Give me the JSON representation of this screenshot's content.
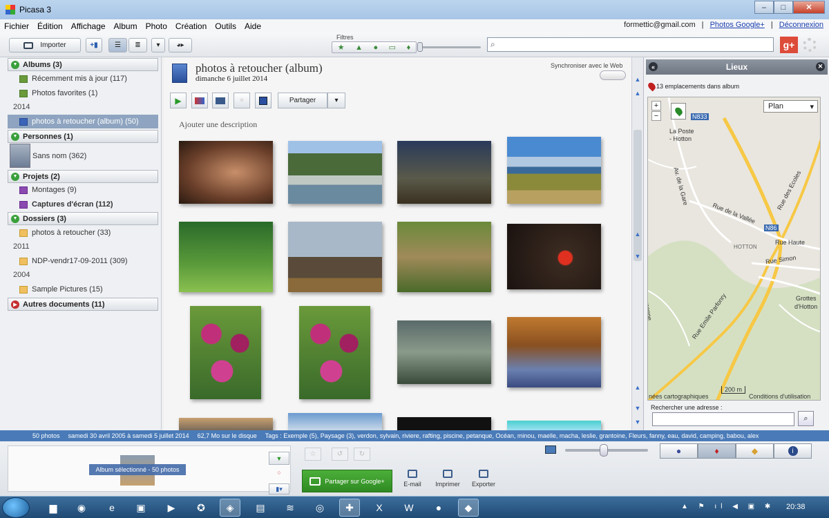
{
  "window": {
    "title": "Picasa 3",
    "min": "–",
    "max": "□",
    "close": "✕"
  },
  "menu": {
    "items": [
      "Fichier",
      "Édition",
      "Affichage",
      "Album",
      "Photo",
      "Création",
      "Outils",
      "Aide"
    ],
    "account": "formettic@gmail.com",
    "google_photos": "Photos Google+",
    "logout": "Déconnexion",
    "sep": "|"
  },
  "toolbar": {
    "import_label": "Importer",
    "filters_label": "Filtres",
    "gplus_label": "g+"
  },
  "sidebar": {
    "albums_header": "Albums (3)",
    "albums": [
      "Récemment mis à jour (117)",
      "Photos favorites (1)"
    ],
    "year_2014": "2014",
    "selected_album": "photos à retoucher (album) (50)",
    "people_header": "Personnes (1)",
    "person": "Sans nom (362)",
    "projects_header": "Projets (2)",
    "projects": [
      "Montages (9)",
      "Captures d'écran (112)"
    ],
    "folders_header": "Dossiers (3)",
    "folder_1": "photos à retoucher (33)",
    "year_2011": "2011",
    "folder_2": "NDP-vendr17-09-2011 (309)",
    "year_2004": "2004",
    "folder_3": "Sample Pictures (15)",
    "other_header": "Autres documents (11)"
  },
  "album": {
    "title": "photos à retoucher (album)",
    "date": "dimanche 6 juillet 2014",
    "sync_label": "Synchroniser avec le Web",
    "share_label": "Partager",
    "add_description": "Ajouter une description"
  },
  "places": {
    "title": "Lieux",
    "count": "13 emplacements dans album",
    "map_type": "Plan",
    "map_labels": {
      "poste": "La Poste",
      "hotton_small": "- Hotton",
      "n833": "N833",
      "av_gare": "Av. de la Gare",
      "rue_ecoles": "Rue des Ecoles",
      "n86": "N86",
      "rue_vallee": "Rue de la Vallée",
      "rue_haute": "Rue Haute",
      "hotton": "HOTTON",
      "rue_simon": "Rue Simon",
      "rue_emile": "Rue Emile Parfonry",
      "grottes": "Grottes",
      "dhotton": "d'Hotton",
      "emenne": "emenne",
      "scale": "200 m",
      "data": "nées cartographiques",
      "conditions": "Conditions d'utilisation"
    },
    "search_label": "Rechercher une adresse :"
  },
  "status": {
    "count": "50 photos",
    "range": "samedi 30 avril 2005 à samedi 5 juillet 2014",
    "size": "62,7 Mo sur le disque",
    "tags": "Tags : Exemple (5), Paysage (3), verdon, sylvain, riviere, rafting, piscine, petanque, Océan, minou, maelle, macha, leslie, grantoine, Fleurs, fanny, eau, david, camping, babou, alex"
  },
  "bottom": {
    "tray_label": "Album sélectionné - 50 photos",
    "share_google": "Partager sur Google+",
    "email": "E-mail",
    "print": "Imprimer",
    "export": "Exporter"
  },
  "taskbar": {
    "clock": "20:38"
  }
}
